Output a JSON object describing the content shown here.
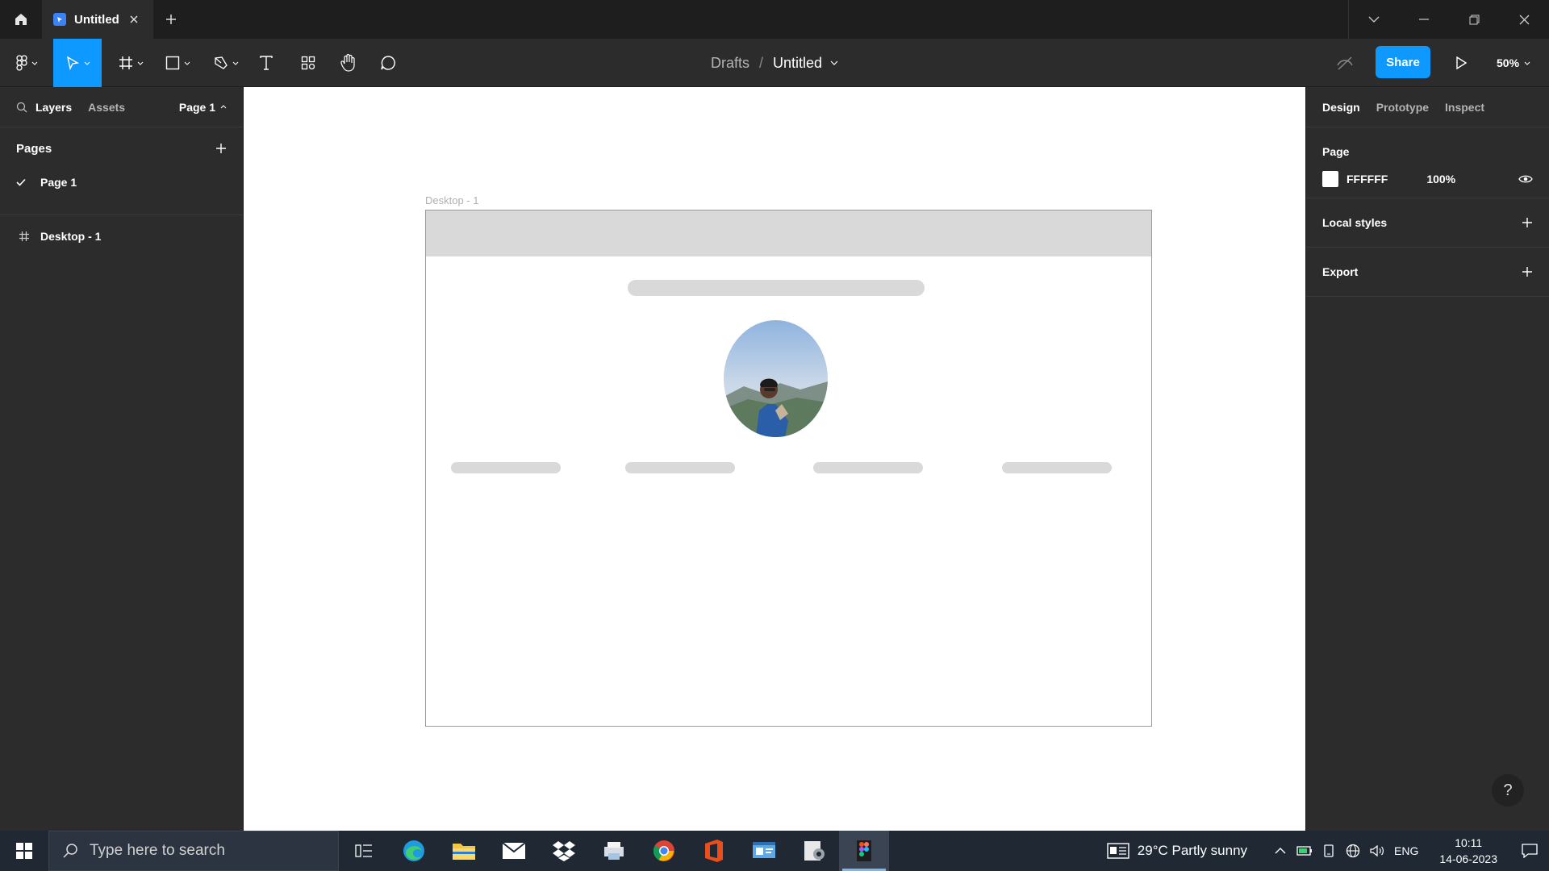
{
  "titlebar": {
    "tab_title": "Untitled"
  },
  "toolbar": {
    "breadcrumb_root": "Drafts",
    "breadcrumb_separator": "/",
    "file_name": "Untitled",
    "share_label": "Share",
    "zoom_label": "50%"
  },
  "left_panel": {
    "tabs": {
      "layers": "Layers",
      "assets": "Assets"
    },
    "page_selector": "Page 1",
    "pages_title": "Pages",
    "pages": [
      {
        "label": "Page 1",
        "selected": true
      }
    ],
    "layers": [
      {
        "label": "Desktop - 1",
        "icon": "frame-icon"
      }
    ]
  },
  "canvas": {
    "frame_label": "Desktop - 1"
  },
  "right_panel": {
    "tabs": {
      "design": "Design",
      "prototype": "Prototype",
      "inspect": "Inspect"
    },
    "page_section_title": "Page",
    "page_color": "FFFFFF",
    "page_opacity": "100%",
    "local_styles_label": "Local styles",
    "export_label": "Export",
    "help_label": "?"
  },
  "taskbar": {
    "search_placeholder": "Type here to search",
    "weather": "29°C  Partly sunny",
    "language": "ENG",
    "time": "10:11",
    "date": "14-06-2023"
  },
  "colors": {
    "accent": "#0d99ff",
    "panel_bg": "#2c2c2c",
    "titlebar_bg": "#1e1e1e",
    "placeholder_gray": "#d9d9d9",
    "taskbar_bg": "#1f2833"
  }
}
